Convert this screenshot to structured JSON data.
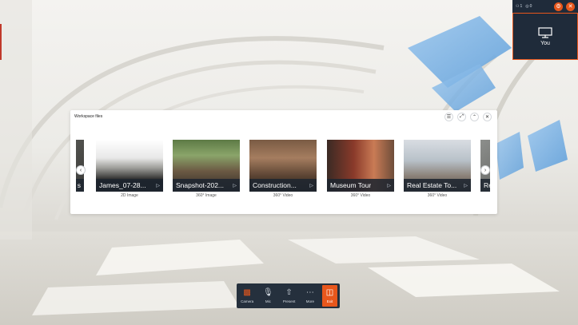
{
  "topbar": {
    "participants_count": "1",
    "signal_value": "0"
  },
  "self_tile": {
    "name": "You"
  },
  "panel": {
    "title": "Workspace files",
    "controls": [
      "list-view",
      "collapse",
      "minimize",
      "close"
    ]
  },
  "files": [
    {
      "label": "James_07-28...",
      "type": "2D Image"
    },
    {
      "label": "Snapshot-202...",
      "type": "360° Image"
    },
    {
      "label": "Construction...",
      "type": "360° Video"
    },
    {
      "label": "Museum Tour",
      "type": "360° Video"
    },
    {
      "label": "Real Estate To...",
      "type": "360° Video"
    }
  ],
  "partial_left_label": "s",
  "partial_right_label": "Re",
  "toolbar": {
    "camera_label": "Camera",
    "mic_label": "Mic",
    "present_label": "Present",
    "more_label": "More",
    "exit_label": "Exit"
  },
  "colors": {
    "accent": "#e8571c",
    "dark_panel": "#1f2b3a"
  }
}
